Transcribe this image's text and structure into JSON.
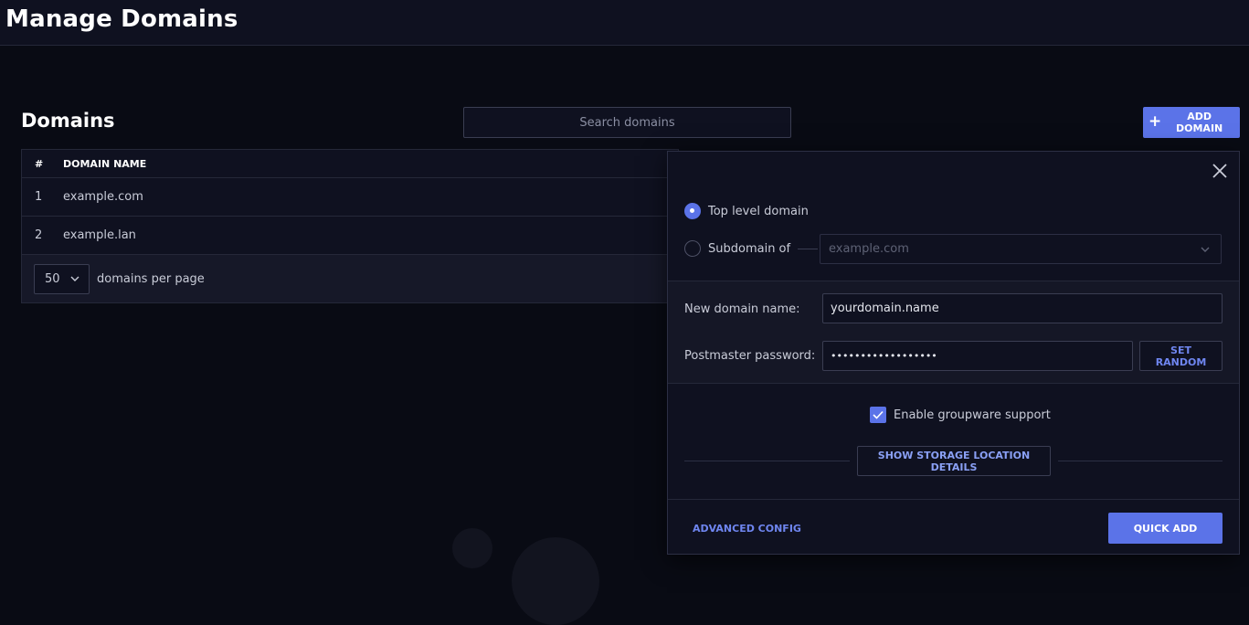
{
  "header": {
    "title": "Manage Domains"
  },
  "domains_section": {
    "title": "Domains",
    "search_placeholder": "Search domains",
    "add_button_label": "ADD DOMAIN"
  },
  "table": {
    "columns": [
      "#",
      "DOMAIN NAME"
    ],
    "rows": [
      {
        "num": "1",
        "name": "example.com"
      },
      {
        "num": "2",
        "name": "example.lan"
      }
    ],
    "per_page_value": "50",
    "per_page_label": "domains per page"
  },
  "add_domain_panel": {
    "radio_top_level": "Top level domain",
    "radio_subdomain": "Subdomain of",
    "subdomain_select_value": "example.com",
    "new_domain_label": "New domain name:",
    "new_domain_value": "yourdomain.name",
    "postmaster_label": "Postmaster password:",
    "postmaster_value": "••••••••••••••••••",
    "set_random_label": "SET RANDOM",
    "groupware_label": "Enable groupware support",
    "groupware_checked": true,
    "storage_button_label": "SHOW STORAGE LOCATION DETAILS",
    "advanced_config_label": "ADVANCED CONFIG",
    "quick_add_label": "QUICK ADD"
  },
  "colors": {
    "accent": "#5b73e8",
    "background": "#090b14",
    "surface": "#0f1120"
  }
}
